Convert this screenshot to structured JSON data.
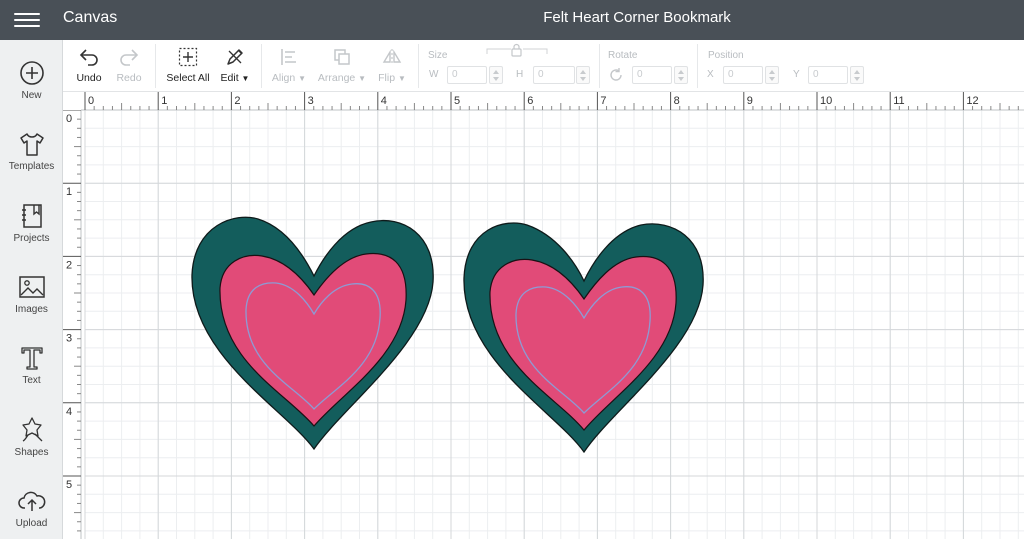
{
  "app": {
    "title": "Canvas",
    "document_title": "Felt Heart Corner Bookmark"
  },
  "sidebar": {
    "items": [
      {
        "label": "New",
        "icon": "plus-circle-icon"
      },
      {
        "label": "Templates",
        "icon": "tshirt-icon"
      },
      {
        "label": "Projects",
        "icon": "notebook-icon"
      },
      {
        "label": "Images",
        "icon": "image-icon"
      },
      {
        "label": "Text",
        "icon": "text-icon"
      },
      {
        "label": "Shapes",
        "icon": "shapes-icon"
      },
      {
        "label": "Upload",
        "icon": "cloud-upload-icon"
      }
    ]
  },
  "toolbar": {
    "undo": "Undo",
    "redo": "Redo",
    "select_all": "Select All",
    "edit": "Edit",
    "align": "Align",
    "arrange": "Arrange",
    "flip": "Flip",
    "size_label": "Size",
    "w_label": "W",
    "w_value": "0",
    "h_label": "H",
    "h_value": "0",
    "rotate_label": "Rotate",
    "rotate_value": "0",
    "position_label": "Position",
    "x_label": "X",
    "x_value": "0",
    "y_label": "Y",
    "y_value": "0"
  },
  "rulers": {
    "horizontal": [
      "0",
      "1",
      "2",
      "3",
      "4",
      "5",
      "6",
      "7",
      "8",
      "9",
      "10",
      "11",
      "12"
    ],
    "vertical": [
      "0",
      "1",
      "2",
      "3",
      "4",
      "5"
    ]
  },
  "colors": {
    "topbar": "#495057",
    "heart_outer": "#135d5c",
    "heart_inner": "#e14b78",
    "heart_score_line": "#8e9bd4",
    "grid_major": "#d4d7da",
    "grid_minor": "#eceef0"
  },
  "canvas": {
    "objects": [
      {
        "name": "heart-layer-group-left"
      },
      {
        "name": "heart-layer-group-right"
      }
    ]
  }
}
